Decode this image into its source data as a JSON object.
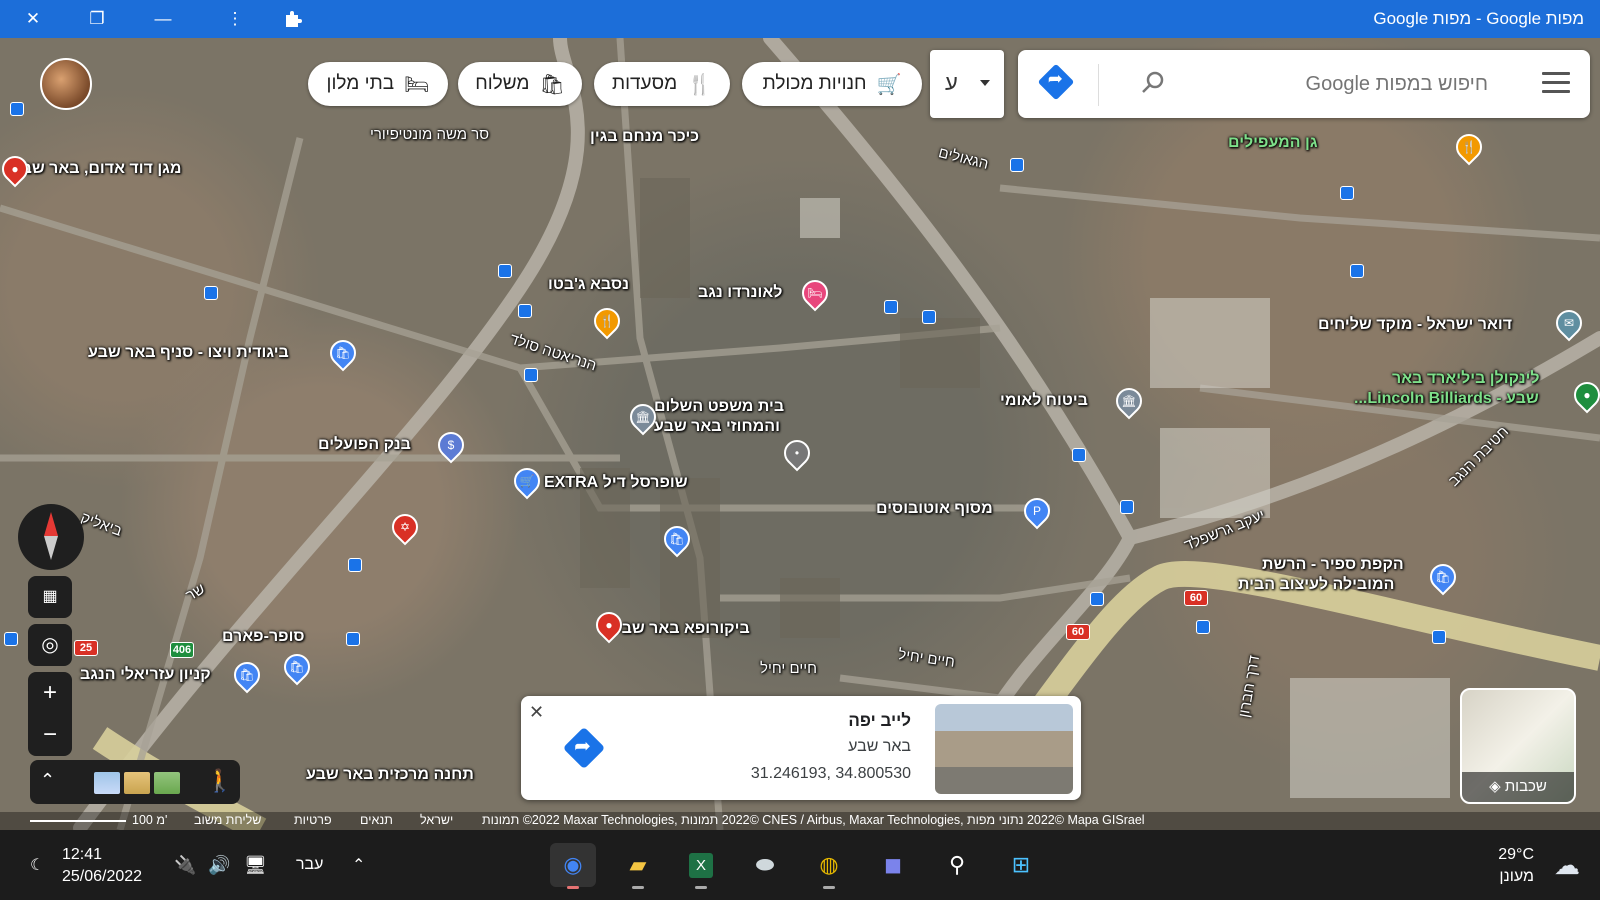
{
  "window": {
    "title": "מפות Google - מפות Google",
    "controls": {
      "close": "✕",
      "restore": "❐",
      "minimize": "—",
      "more": "⋮",
      "extensions": "puzzle-icon"
    }
  },
  "search": {
    "placeholder": "חיפוש במפות Google",
    "menu_icon": "menu-icon",
    "search_icon": "search-icon",
    "directions_icon": "directions-icon"
  },
  "language_button": {
    "label": "ע"
  },
  "chips": [
    {
      "label": "חנויות מכולת",
      "icon": "cart-icon",
      "glyph": "🛒"
    },
    {
      "label": "מסעדות",
      "icon": "restaurant-icon",
      "glyph": "🍴"
    },
    {
      "label": "משלוח",
      "icon": "delivery-icon",
      "glyph": "🛍"
    },
    {
      "label": "בתי מלון",
      "icon": "hotel-icon",
      "glyph": "🛏"
    }
  ],
  "map_labels": {
    "meir_garden": "כיכר מנחם בגין",
    "gan_hamefalim": "גן המעפילים",
    "david_adom": "מגן דוד אדום, באר שבע",
    "montefiore": "סר משה מונטיפיורי",
    "nesba": "נסבא ג'בטו",
    "leonardo": "לאונרדו נגב",
    "doar": "דואר ישראל - מוקד שליחים",
    "lincoln": "לינקולן ביליארד באר",
    "lincoln2": "שבע - Lincoln Billiards...",
    "vizu": "ביגודית ויצו - סניף באר שבע",
    "court": "בית משפט השלום",
    "court2": "והמחוזי באר שבע",
    "bituach": "ביטוח לאומי",
    "poalim": "בנק הפועלים",
    "shufersal": "שופרסל דיל EXTRA",
    "masof": "מסוף אוטובוסים",
    "hakafat": "הקפת ספיר - הרשת",
    "hakafat2": "המובילה לעיצוב הבית",
    "super_pharm": "סופר-פארם",
    "biocofa": "ביקורופא באר שבע",
    "azrieli": "קניון עזריאלי הנגב",
    "central_station": "תחנה מרכזית באר שבע",
    "street_haim_yahil": "חיים יחיל",
    "street_haim_yahil2": "חיים יחיל",
    "street_yaakov": "יעקב גרשפלד",
    "street_hagaulim": "הגאולים",
    "street_hanrieta": "הנריאטה סולד",
    "street_bialik": "ביאליק",
    "street_shar": "שר",
    "street_hativat": "חטיבת הנגב",
    "street_beit_hanegev": "דרך חברון"
  },
  "road_shields": [
    "25",
    "406",
    "60",
    "60"
  ],
  "controls": {
    "compass": "compass-icon",
    "zoom_in": "+",
    "zoom_out": "−",
    "layer_label": "שכבות"
  },
  "place_card": {
    "name": "לייב יפה",
    "city": "באר שבע",
    "coords": "31.246193, 34.800530"
  },
  "attribution": {
    "scale": "100 מ'",
    "send_feedback": "שליחת משוב",
    "privacy": "פרטיות",
    "terms": "תנאים",
    "israel": "ישראל",
    "imagery": "תמונות ‎©2022 Maxar Technologies, ‏©2022 תמונות CNES / Airbus, Maxar Technologies, ‏©2022 נתוני מפות Mapa GISrael"
  },
  "taskbar": {
    "time": "12:41",
    "date": "25/06/2022",
    "language": "עבר",
    "temperature": "29°C",
    "weather": "מעונן",
    "apps": [
      "maps-app-icon",
      "file-explorer-icon",
      "excel-icon",
      "scanner-icon",
      "chrome-icon",
      "chat-icon",
      "search-icon",
      "windows-start-icon"
    ]
  },
  "colors": {
    "titlebar": "#1c6ed9",
    "accent_blue": "#1a73e8",
    "pin_red": "#d93025"
  }
}
